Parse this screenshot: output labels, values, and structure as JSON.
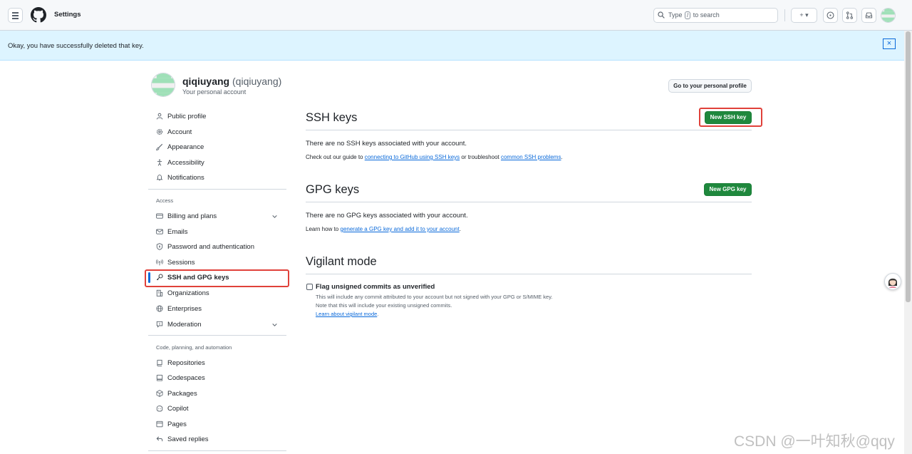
{
  "header": {
    "title": "Settings",
    "search_prefix": "Type",
    "search_key": "/",
    "search_suffix": "to search",
    "plus_label": "+ ▾"
  },
  "flash": {
    "message": "Okay, you have successfully deleted that key.",
    "close_label": "×"
  },
  "account": {
    "name": "qiqiuyang",
    "login": "(qiqiuyang)",
    "subtitle": "Your personal account",
    "profile_button": "Go to your personal profile"
  },
  "sidebar": {
    "group1": [
      "Public profile",
      "Account",
      "Appearance",
      "Accessibility",
      "Notifications"
    ],
    "access_heading": "Access",
    "access": [
      "Billing and plans",
      "Emails",
      "Password and authentication",
      "Sessions",
      "SSH and GPG keys",
      "Organizations",
      "Enterprises",
      "Moderation"
    ],
    "code_heading": "Code, planning, and automation",
    "code": [
      "Repositories",
      "Codespaces",
      "Packages",
      "Copilot",
      "Pages",
      "Saved replies"
    ]
  },
  "ssh": {
    "title": "SSH keys",
    "button": "New SSH key",
    "empty": "There are no SSH keys associated with your account.",
    "guide_pre": "Check out our guide to",
    "guide_link": "connecting to GitHub using SSH keys",
    "guide_mid": "or troubleshoot",
    "guide_link2": "common SSH problems",
    "guide_end": "."
  },
  "gpg": {
    "title": "GPG keys",
    "button": "New GPG key",
    "empty": "There are no GPG keys associated with your account.",
    "learn_pre": "Learn how to",
    "learn_link": "generate a GPG key and add it to your account",
    "learn_end": "."
  },
  "vigilant": {
    "title": "Vigilant mode",
    "checkbox_label": "Flag unsigned commits as unverified",
    "line1": "This will include any commit attributed to your account but not signed with your GPG or S/MIME key.",
    "line2": "Note that this will include your existing unsigned commits.",
    "link": "Learn about vigilant mode",
    "link_end": "."
  },
  "watermark": "CSDN @一叶知秋@qqy",
  "colors": {
    "accent": "#0969da",
    "primary_button": "#1f883d",
    "highlight_box": "#e0413a",
    "flash_bg": "#ddf4ff"
  }
}
